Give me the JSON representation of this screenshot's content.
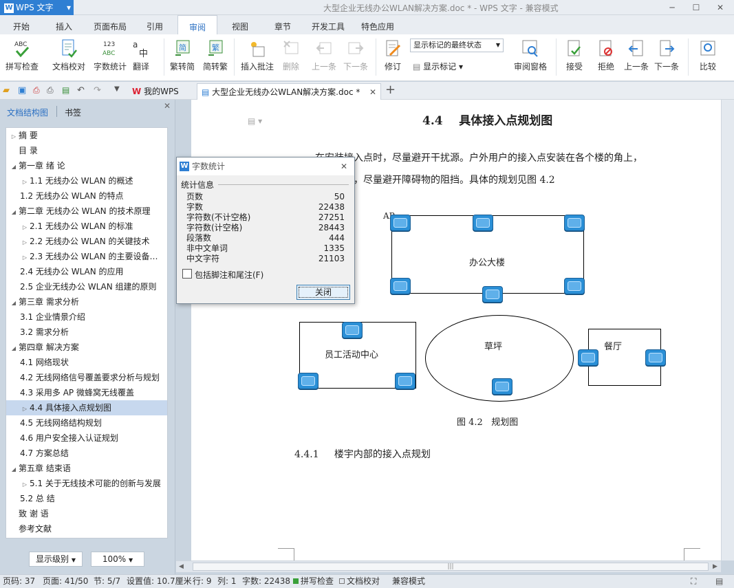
{
  "title_bar": {
    "app_name": "WPS 文字",
    "document_title": "大型企业无线办公WLAN解决方案.doc * - WPS 文字 - 兼容模式"
  },
  "menu_tabs": [
    "开始",
    "插入",
    "页面布局",
    "引用",
    "审阅",
    "视图",
    "章节",
    "开发工具",
    "特色应用"
  ],
  "active_menu_tab": "审阅",
  "ribbon": {
    "spell_check": "拼写检查",
    "doc_proofread": "文档校对",
    "word_count": "字数统计",
    "translate": "翻译",
    "trad_to_simp": "繁转简",
    "simp_to_trad": "简转繁",
    "insert_comment": "插入批注",
    "delete": "删除",
    "previous": "上一条",
    "next": "下一条",
    "track_changes": "修订",
    "show_markup_state": "显示标记的最终状态",
    "show_markup": "显示标记",
    "review_pane": "审阅窗格",
    "accept": "接受",
    "reject": "拒绝",
    "prev_change": "上一条",
    "next_change": "下一条",
    "compare": "比较"
  },
  "doc_tabs": {
    "home": "我的WPS",
    "active": "大型企业无线办公WLAN解决方案.doc *"
  },
  "nav_pane": {
    "tab_structure": "文档结构图",
    "tab_bookmarks": "书签",
    "items": [
      {
        "label": "摘    要",
        "level": "l1",
        "toggle": "▷"
      },
      {
        "label": "目    录",
        "level": "l1nt",
        "toggle": ""
      },
      {
        "label": "第一章   绪  论",
        "level": "l1",
        "toggle": "◢"
      },
      {
        "label": "1.1   无线办公 WLAN 的概述",
        "level": "l2",
        "toggle": "▷"
      },
      {
        "label": "1.2   无线办公 WLAN 的特点",
        "level": "l2",
        "toggle": ""
      },
      {
        "label": "第二章   无线办公 WLAN 的技术原理",
        "level": "l1",
        "toggle": "◢"
      },
      {
        "label": "2.1   无线办公 WLAN 的标准",
        "level": "l2",
        "toggle": "▷"
      },
      {
        "label": "2.2   无线办公 WLAN 的关键技术",
        "level": "l2",
        "toggle": "▷"
      },
      {
        "label": "2.3   无线办公 WLAN 的主要设备组成",
        "level": "l2",
        "toggle": "▷"
      },
      {
        "label": "2.4   无线办公 WLAN 的应用",
        "level": "l2",
        "toggle": ""
      },
      {
        "label": "2.5   企业无线办公 WLAN 组建的原则",
        "level": "l2",
        "toggle": ""
      },
      {
        "label": "第三章   需求分析",
        "level": "l1",
        "toggle": "◢"
      },
      {
        "label": "3.1   企业情景介绍",
        "level": "l2",
        "toggle": ""
      },
      {
        "label": "3.2   需求分析",
        "level": "l2",
        "toggle": ""
      },
      {
        "label": "第四章   解决方案",
        "level": "l1",
        "toggle": "◢"
      },
      {
        "label": "4.1   网络现状",
        "level": "l2",
        "toggle": ""
      },
      {
        "label": "4.2   无线网络信号覆盖要求分析与规划",
        "level": "l2",
        "toggle": ""
      },
      {
        "label": "4.3   采用多 AP 微蜂窝无线覆盖",
        "level": "l2",
        "toggle": ""
      },
      {
        "label": "4.4   具体接入点规划图",
        "level": "l2",
        "toggle": "▷",
        "selected": true
      },
      {
        "label": "4.5   无线网络结构规划",
        "level": "l2",
        "toggle": ""
      },
      {
        "label": "4.6   用户安全接入认证规划",
        "level": "l2",
        "toggle": ""
      },
      {
        "label": "4.7   方案总结",
        "level": "l2",
        "toggle": ""
      },
      {
        "label": "第五章   结束语",
        "level": "l1",
        "toggle": "◢"
      },
      {
        "label": "5.1   关于无线技术可能的创新与发展",
        "level": "l2",
        "toggle": "▷"
      },
      {
        "label": "5.2   总    结",
        "level": "l2",
        "toggle": ""
      },
      {
        "label": "致 谢 语",
        "level": "l1nt",
        "toggle": ""
      },
      {
        "label": "参考文献",
        "level": "l1nt",
        "toggle": ""
      }
    ],
    "show_level": "显示级别",
    "zoom": "100%"
  },
  "document": {
    "heading": "4.4    具体接入点规划图",
    "para_line1": "在安装接入点时，尽量避开干扰源。户外用户的接入点安装在各个楼的角上，",
    "para_line2": "覆盖区域，尽量避开障碍物的阻挡。具体的规划见图 4.2",
    "ap_label": "AP",
    "office_building": "办公大楼",
    "staff_center": "员工活动中心",
    "lawn": "草坪",
    "canteen": "餐厅",
    "figure_caption": "图 4.2   规划图",
    "subheading": "4.4.1     楼宇内部的接入点规划"
  },
  "word_count_dialog": {
    "title": "字数统计",
    "section": "统计信息",
    "stats": [
      {
        "label": "页数",
        "value": "50"
      },
      {
        "label": "字数",
        "value": "22438"
      },
      {
        "label": "字符数(不计空格)",
        "value": "27251"
      },
      {
        "label": "字符数(计空格)",
        "value": "28443"
      },
      {
        "label": "段落数",
        "value": "444"
      },
      {
        "label": "非中文单词",
        "value": "1335"
      },
      {
        "label": "中文字符",
        "value": "21103"
      }
    ],
    "include_footnotes": "包括脚注和尾注(F)",
    "close": "关闭"
  },
  "status_bar": {
    "page_code": "页码: 37",
    "page": "页面: 41/50",
    "section": "节: 5/7",
    "position": "设置值: 10.7厘米",
    "line": "行: 9",
    "column": "列: 1",
    "word_count": "字数: 22438",
    "spell_check": "拼写检查",
    "doc_proofread": "文档校对",
    "compat_mode": "兼容模式"
  },
  "colors": {
    "accent": "#2f7fd3",
    "ap_icon": "#2a8fd6",
    "nav_selected": "#c7d8ee"
  }
}
